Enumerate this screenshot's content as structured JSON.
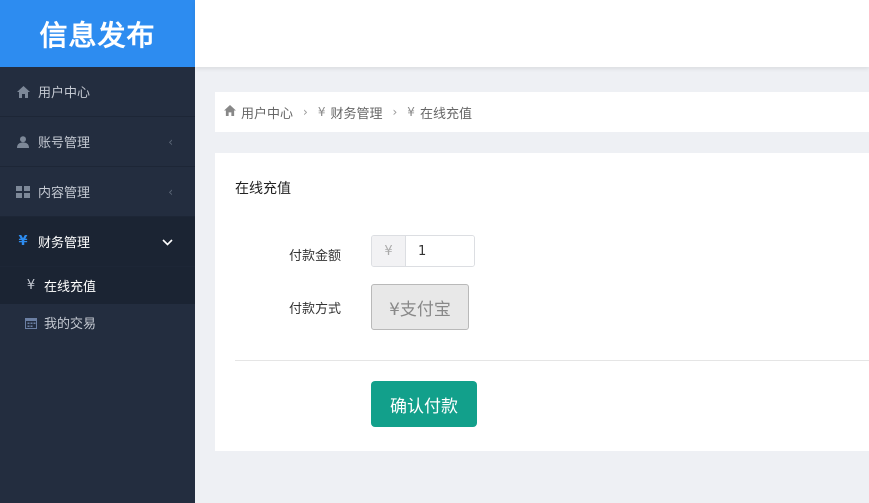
{
  "app": {
    "logo_text": "信息发布"
  },
  "sidebar": {
    "items": [
      {
        "label": "用户中心",
        "icon": "home-icon"
      },
      {
        "label": "账号管理",
        "icon": "user-icon",
        "chevron": "‹"
      },
      {
        "label": "内容管理",
        "icon": "grid-icon",
        "chevron": "‹"
      },
      {
        "label": "财务管理",
        "icon": "yen-icon",
        "chevron": "⌄",
        "active": true
      }
    ],
    "subitems": [
      {
        "label": "在线充值",
        "icon": "yen-icon",
        "active": true
      },
      {
        "label": "我的交易",
        "icon": "calendar-icon"
      }
    ]
  },
  "breadcrumb": {
    "items": [
      {
        "label": "用户中心",
        "icon": "home-icon"
      },
      {
        "label": "财务管理",
        "icon": "yen-icon"
      },
      {
        "label": "在线充值",
        "icon": "yen-icon"
      }
    ],
    "separator": "›"
  },
  "panel": {
    "title": "在线充值",
    "amount_label": "付款金额",
    "currency_symbol": "¥",
    "amount_value": "1",
    "method_label": "付款方式",
    "method_option": "¥支付宝",
    "confirm_label": "确认付款"
  },
  "colors": {
    "brand": "#2d8cf0",
    "sidebar_bg": "#232d3f",
    "confirm_button": "#12a08b"
  }
}
